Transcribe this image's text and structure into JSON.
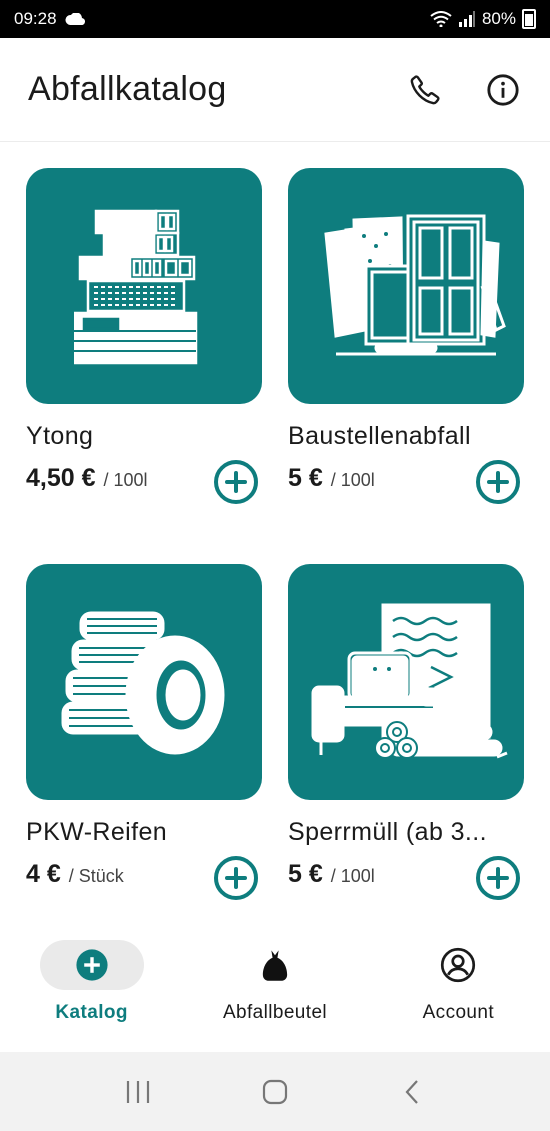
{
  "status": {
    "time": "09:28",
    "battery": "80%"
  },
  "header": {
    "title": "Abfallkatalog",
    "phone_icon": "phone-icon",
    "info_icon": "info-icon"
  },
  "catalog": {
    "items": [
      {
        "name": "Ytong",
        "price": "4,50 €",
        "unit": "/ 100l",
        "icon": "ytong-blocks-icon"
      },
      {
        "name": "Baustellenabfall",
        "price": "5 €",
        "unit": "/ 100l",
        "icon": "construction-waste-icon"
      },
      {
        "name": "PKW-Reifen",
        "price": "4 €",
        "unit": "/ Stück",
        "icon": "tires-icon"
      },
      {
        "name": "Sperrmüll (ab 3...",
        "price": "5 €",
        "unit": "/ 100l",
        "icon": "bulky-waste-icon"
      }
    ]
  },
  "nav": {
    "items": [
      {
        "label": "Katalog",
        "icon": "plus-circle-icon",
        "active": true
      },
      {
        "label": "Abfallbeutel",
        "icon": "waste-bag-icon",
        "active": false
      },
      {
        "label": "Account",
        "icon": "account-icon",
        "active": false
      }
    ]
  },
  "colors": {
    "accent": "#0e7d7e",
    "nav_active_bg": "#eaeaea"
  }
}
